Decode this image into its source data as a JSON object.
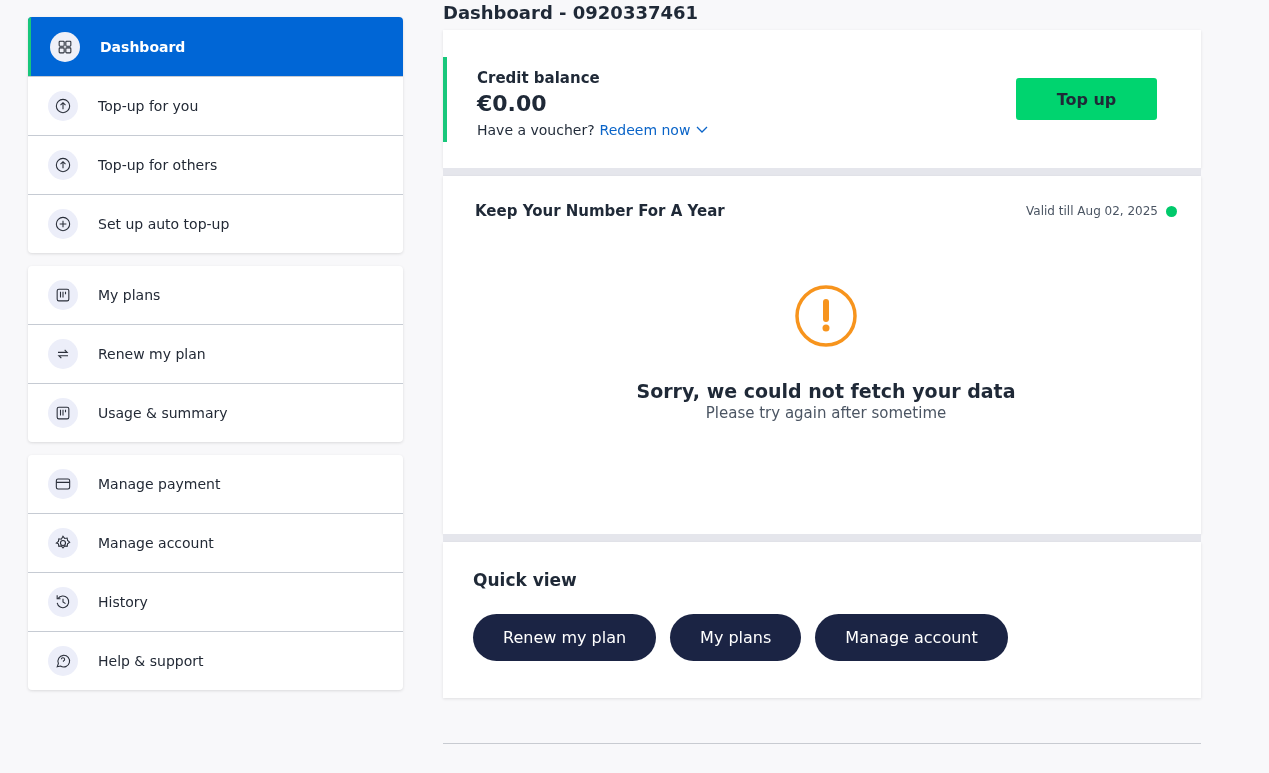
{
  "page_title": "Dashboard - 0920337461",
  "sidebar": {
    "groups": [
      {
        "items": [
          {
            "label": "Dashboard",
            "selected": true
          },
          {
            "label": "Top-up for you",
            "selected": false
          },
          {
            "label": "Top-up for others",
            "selected": false
          },
          {
            "label": "Set up auto top-up",
            "selected": false
          }
        ]
      },
      {
        "items": [
          {
            "label": "My plans",
            "selected": false
          },
          {
            "label": "Renew my plan",
            "selected": false
          },
          {
            "label": "Usage & summary",
            "selected": false
          }
        ]
      },
      {
        "items": [
          {
            "label": "Manage payment",
            "selected": false
          },
          {
            "label": "Manage account",
            "selected": false
          },
          {
            "label": "History",
            "selected": false
          },
          {
            "label": "Help & support",
            "selected": false
          }
        ]
      }
    ]
  },
  "credit": {
    "label": "Credit balance",
    "amount": "€0.00",
    "voucher_text": "Have a voucher?",
    "redeem_link": "Redeem now",
    "button": "Top up"
  },
  "plan_card": {
    "title": "Keep Your Number For A Year",
    "validity": "Valid till Aug 02, 2025",
    "error_title": "Sorry, we could not fetch your data",
    "error_subtitle": "Please try again after sometime"
  },
  "quick_view": {
    "title": "Quick view",
    "buttons": [
      "Renew my plan",
      "My plans",
      "Manage account"
    ]
  }
}
